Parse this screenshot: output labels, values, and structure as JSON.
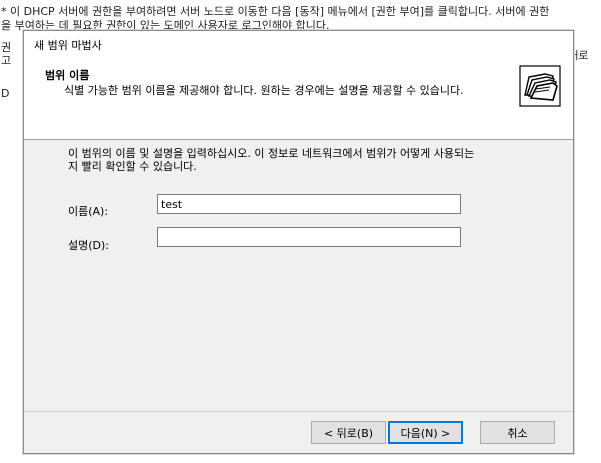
{
  "background": {
    "line1": "* 이 DHCP 서버에 권한을 부여하려면 서버 노드로 이동한 다음 [동작] 메뉴에서 [권한 부여]를 클릭합니다. 서버에 권한",
    "line2": "을 부여하는 데 필요한 권한이 있는 도메인 사용자로 로그인해야 합니다.",
    "left_frag1": "권",
    "left_frag2": "고",
    "left_frag3": "D",
    "right_frag1": "[새로"
  },
  "dialog": {
    "title": "새 범위 마법사",
    "header": {
      "title": "범위 이름",
      "subtitle": "식별 가능한 범위 이름을 제공해야 합니다. 원하는 경우에는 설명을 제공할 수 있습니다.",
      "icon": "folder-wizard-icon"
    },
    "instruction_line1": "이 범위의 이름 및 설명을 입력하십시오. 이 정보로 네트워크에서 범위가 어떻게 사용되는",
    "instruction_line2": "지 빨리 확인할 수 있습니다.",
    "name_label": "이름(A):",
    "name_value": "test",
    "description_label": "설명(D):",
    "description_value": "",
    "buttons": {
      "back": "< 뒤로(B)",
      "next": "다음(N) >",
      "cancel": "취소"
    }
  }
}
